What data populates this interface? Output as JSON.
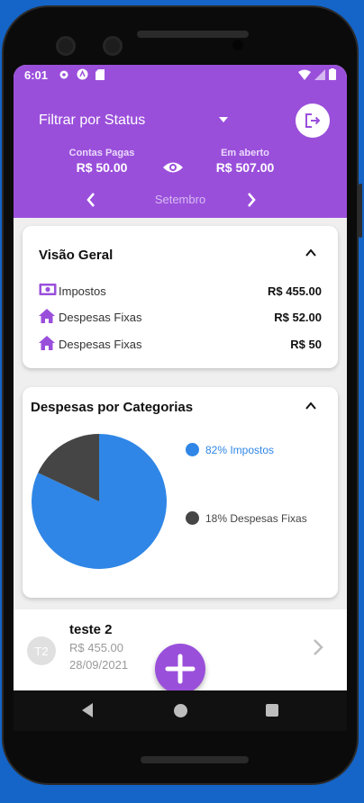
{
  "status_bar": {
    "time": "6:01"
  },
  "header": {
    "filter_label": "Filtrar por Status",
    "paid_label": "Contas Pagas",
    "paid_value": "R$ 50.00",
    "open_label": "Em aberto",
    "open_value": "R$ 507.00",
    "month": "Setembro"
  },
  "overview": {
    "title": "Visão Geral",
    "rows": [
      {
        "icon": "money-icon",
        "label": "Impostos",
        "amount": "R$ 455.00"
      },
      {
        "icon": "home-icon",
        "label": "Despesas Fixas",
        "amount": "R$ 52.00"
      },
      {
        "icon": "home-icon",
        "label": "Despesas Fixas",
        "amount": "R$ 50"
      }
    ]
  },
  "categories": {
    "title": "Despesas por Categorias",
    "legend": [
      {
        "label": "82% Impostos",
        "color": "#2f86e6"
      },
      {
        "label": "18% Despesas Fixas",
        "color": "#454545"
      }
    ]
  },
  "chart_data": {
    "type": "pie",
    "categories": [
      "Impostos",
      "Despesas Fixas"
    ],
    "values": [
      82,
      18
    ],
    "colors": [
      "#2f86e6",
      "#454545"
    ]
  },
  "transaction": {
    "avatar": "T2",
    "title": "teste 2",
    "amount": "R$ 455.00",
    "date": "28/09/2021"
  },
  "colors": {
    "primary": "#9a4fdb",
    "accent_blue": "#2f86e6",
    "background": "#1565c8"
  }
}
